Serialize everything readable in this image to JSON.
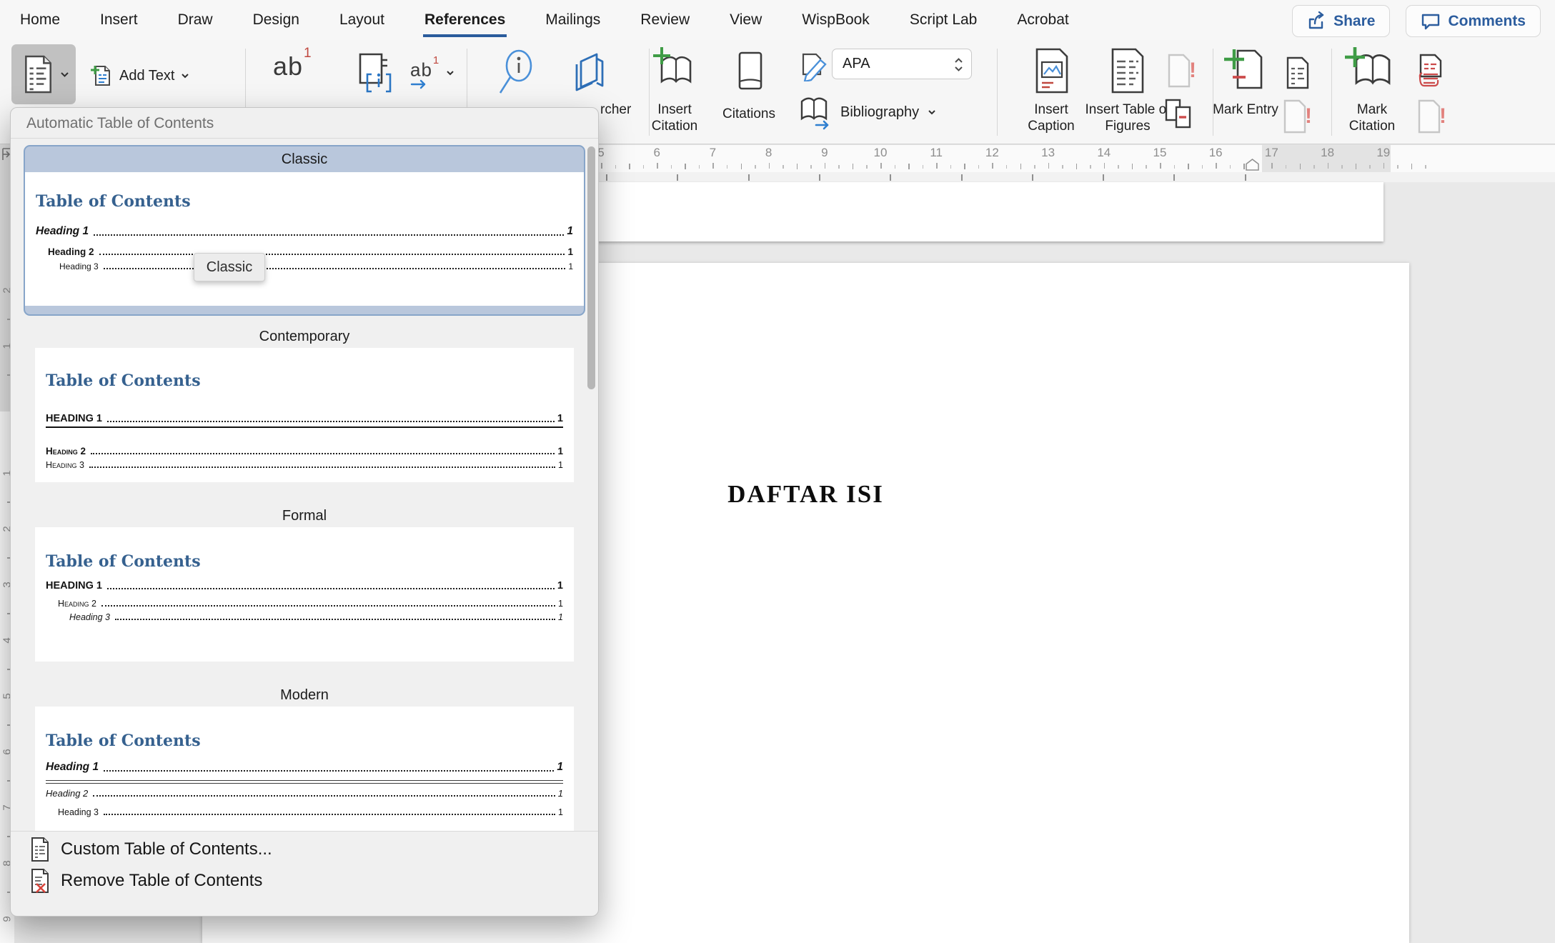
{
  "menu_bar": {
    "tabs": [
      {
        "label": "Home",
        "active": false
      },
      {
        "label": "Insert",
        "active": false
      },
      {
        "label": "Draw",
        "active": false
      },
      {
        "label": "Design",
        "active": false
      },
      {
        "label": "Layout",
        "active": false
      },
      {
        "label": "References",
        "active": true
      },
      {
        "label": "Mailings",
        "active": false
      },
      {
        "label": "Review",
        "active": false
      },
      {
        "label": "View",
        "active": false
      },
      {
        "label": "WispBook",
        "active": false
      },
      {
        "label": "Script Lab",
        "active": false
      },
      {
        "label": "Acrobat",
        "active": false
      }
    ],
    "share_label": "Share",
    "comments_label": "Comments"
  },
  "ribbon": {
    "add_text": "Add Text",
    "footnote_glyph": "ab",
    "footnote_sup": "1",
    "next_footnote_glyph": "ab",
    "next_footnote_sup": "1",
    "endnote_glyph": "[i]",
    "researcher_visible": "rcher",
    "insert_citation": "Insert Citation",
    "citations": "Citations",
    "style_value": "APA",
    "bibliography": "Bibliography",
    "insert_caption": "Insert Caption",
    "insert_table_of_figures": "Insert Table of Figures",
    "mark_entry": "Mark Entry",
    "mark_citation": "Mark Citation"
  },
  "ruler": {
    "horizontal_numbers": [
      "5",
      "6",
      "7",
      "8",
      "9",
      "10",
      "11",
      "12",
      "13",
      "14",
      "15",
      "16",
      "17",
      "18",
      "19"
    ],
    "vertical_numbers_upper": [
      "2",
      "1"
    ],
    "vertical_numbers_lower": [
      "1",
      "2",
      "3",
      "4",
      "5",
      "6",
      "7",
      "8",
      "9"
    ]
  },
  "toc_dropdown": {
    "header": "Automatic Table of Contents",
    "tooltip": "Classic",
    "styles": [
      {
        "name": "Classic",
        "selected": true,
        "title": "Table of Contents",
        "entries": [
          {
            "text": "Heading 1",
            "page": "1",
            "fmt": "bold italic",
            "level": 1
          },
          {
            "text": "Heading 2",
            "page": "1",
            "fmt": "bold",
            "level": 2
          },
          {
            "text": "Heading 3",
            "page": "1",
            "fmt": "plain",
            "level": 3
          }
        ]
      },
      {
        "name": "Contemporary",
        "selected": false,
        "title": "Table of Contents",
        "entries": [
          {
            "text": "HEADING 1",
            "page": "1",
            "fmt": "bold underline",
            "level": 1
          },
          {
            "text": "Heading 2",
            "page": "1",
            "fmt": "bold smallcaps",
            "level": 1
          },
          {
            "text": "Heading 3",
            "page": "1",
            "fmt": "smallcaps",
            "level": 1
          }
        ]
      },
      {
        "name": "Formal",
        "selected": false,
        "title": "Table of Contents",
        "entries": [
          {
            "text": "HEADING 1",
            "page": "1",
            "fmt": "bold",
            "level": 1
          },
          {
            "text": "Heading 2",
            "page": "1",
            "fmt": "smallcaps",
            "level": 2
          },
          {
            "text": "Heading 3",
            "page": "1",
            "fmt": "italic",
            "level": 3
          }
        ]
      },
      {
        "name": "Modern",
        "selected": false,
        "title": "Table of Contents",
        "entries": [
          {
            "text": "Heading 1",
            "page": "1",
            "fmt": "bold italic doubleafter",
            "level": 1
          },
          {
            "text": "Heading 2",
            "page": "1",
            "fmt": "italic",
            "level": 1
          },
          {
            "text": "Heading 3",
            "page": "1",
            "fmt": "plain",
            "level": 2
          }
        ]
      }
    ],
    "footer_items": [
      {
        "label": "Custom Table of Contents...",
        "icon": "custom-toc-icon"
      },
      {
        "label": "Remove Table of Contents",
        "icon": "remove-toc-icon"
      }
    ]
  },
  "document": {
    "title": "DAFTAR ISI"
  },
  "colors": {
    "accent_blue": "#2b5c9c",
    "selection_blue": "#b9c7dc",
    "selection_border": "#87a5c9",
    "toc_title_blue": "#36618f",
    "green_plus": "#3f9c46",
    "red_accent": "#c0483f"
  }
}
